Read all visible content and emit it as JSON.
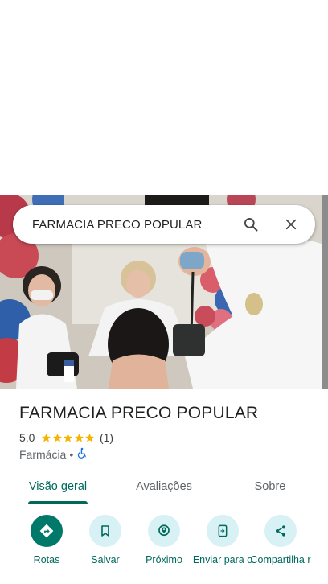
{
  "search": {
    "query": "FARMACIA PRECO POPULAR"
  },
  "place": {
    "name": "FARMACIA PRECO POPULAR",
    "rating": "5,0",
    "stars": 5,
    "review_count": "(1)",
    "category": "Farmácia",
    "separator": "•",
    "accessibility_icon": "wheelchair-icon"
  },
  "tabs": [
    {
      "label": "Visão geral",
      "active": true
    },
    {
      "label": "Avaliações",
      "active": false
    },
    {
      "label": "Sobre",
      "active": false
    }
  ],
  "actions": [
    {
      "label": "Rotas",
      "icon": "directions-icon"
    },
    {
      "label": "Salvar",
      "icon": "bookmark-icon"
    },
    {
      "label": "Próximo",
      "icon": "nearby-icon"
    },
    {
      "label": "Enviar para o",
      "icon": "send-to-phone-icon"
    },
    {
      "label": "Compartilha r",
      "icon": "share-icon"
    }
  ],
  "colors": {
    "accent": "#00695c",
    "primary_button": "#00796b",
    "button_tint": "#d7f1f5",
    "star": "#f4b400"
  }
}
